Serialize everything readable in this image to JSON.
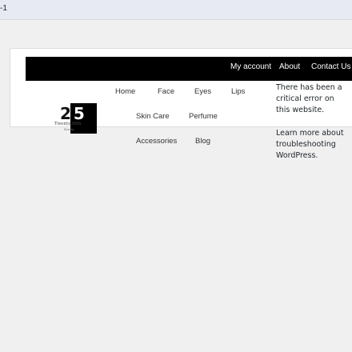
{
  "browser": {
    "tab_title": "-1"
  },
  "header": {
    "links": [
      "My account",
      "About",
      "Contact Us"
    ]
  },
  "nav": {
    "row1": [
      "Home",
      "Face",
      "Eyes",
      "Lips"
    ],
    "row2": [
      "Skin Care",
      "Perfume"
    ],
    "row3": [
      "Accessories",
      "Blog"
    ]
  },
  "logo": {
    "number": "25",
    "name": "Twenty fifth",
    "tagline": "Beauty"
  },
  "error": {
    "message": "There has been a critical error on this website.",
    "link": "Learn more about troubleshooting WordPress."
  },
  "colors": {
    "top_bar": "#000000",
    "page_bg": "#f0f0f1",
    "card_bg": "#ffffff"
  }
}
